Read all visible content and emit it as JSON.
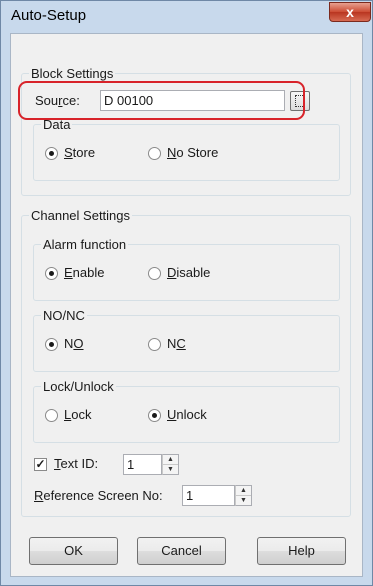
{
  "window": {
    "title": "Auto-Setup",
    "close_glyph": "x"
  },
  "block_settings": {
    "legend": "Block Settings",
    "source": {
      "label_pre": "Sou",
      "label_ul": "r",
      "label_post": "ce:",
      "value": "D 00100"
    },
    "data": {
      "legend": "Data",
      "options": [
        {
          "ul": "S",
          "rest": "tore",
          "selected": true
        },
        {
          "ul": "N",
          "rest": "o Store",
          "selected": false
        }
      ]
    }
  },
  "channel_settings": {
    "legend": "Channel Settings",
    "alarm_function": {
      "legend": "Alarm function",
      "options": [
        {
          "ul": "E",
          "rest": "nable",
          "selected": true
        },
        {
          "ul": "D",
          "rest": "isable",
          "selected": false
        }
      ]
    },
    "no_nc": {
      "legend": "NO/NC",
      "options": [
        {
          "pre": "N",
          "ul": "O",
          "selected": true
        },
        {
          "pre": "N",
          "ul": "C",
          "selected": false
        }
      ]
    },
    "lock_unlock": {
      "legend": "Lock/Unlock",
      "options": [
        {
          "ul": "L",
          "rest": "ock",
          "selected": false
        },
        {
          "ul": "U",
          "rest": "nlock",
          "selected": true
        }
      ]
    },
    "text_id": {
      "checked": true,
      "check_glyph": "✓",
      "ul": "T",
      "rest": "ext ID:",
      "value": "1"
    },
    "reference_screen": {
      "ul": "R",
      "rest": "eference Screen No:",
      "value": "1"
    }
  },
  "buttons": {
    "ok": "OK",
    "cancel": "Cancel",
    "help": "Help"
  },
  "spin_glyphs": {
    "up": "▲",
    "down": "▼"
  }
}
